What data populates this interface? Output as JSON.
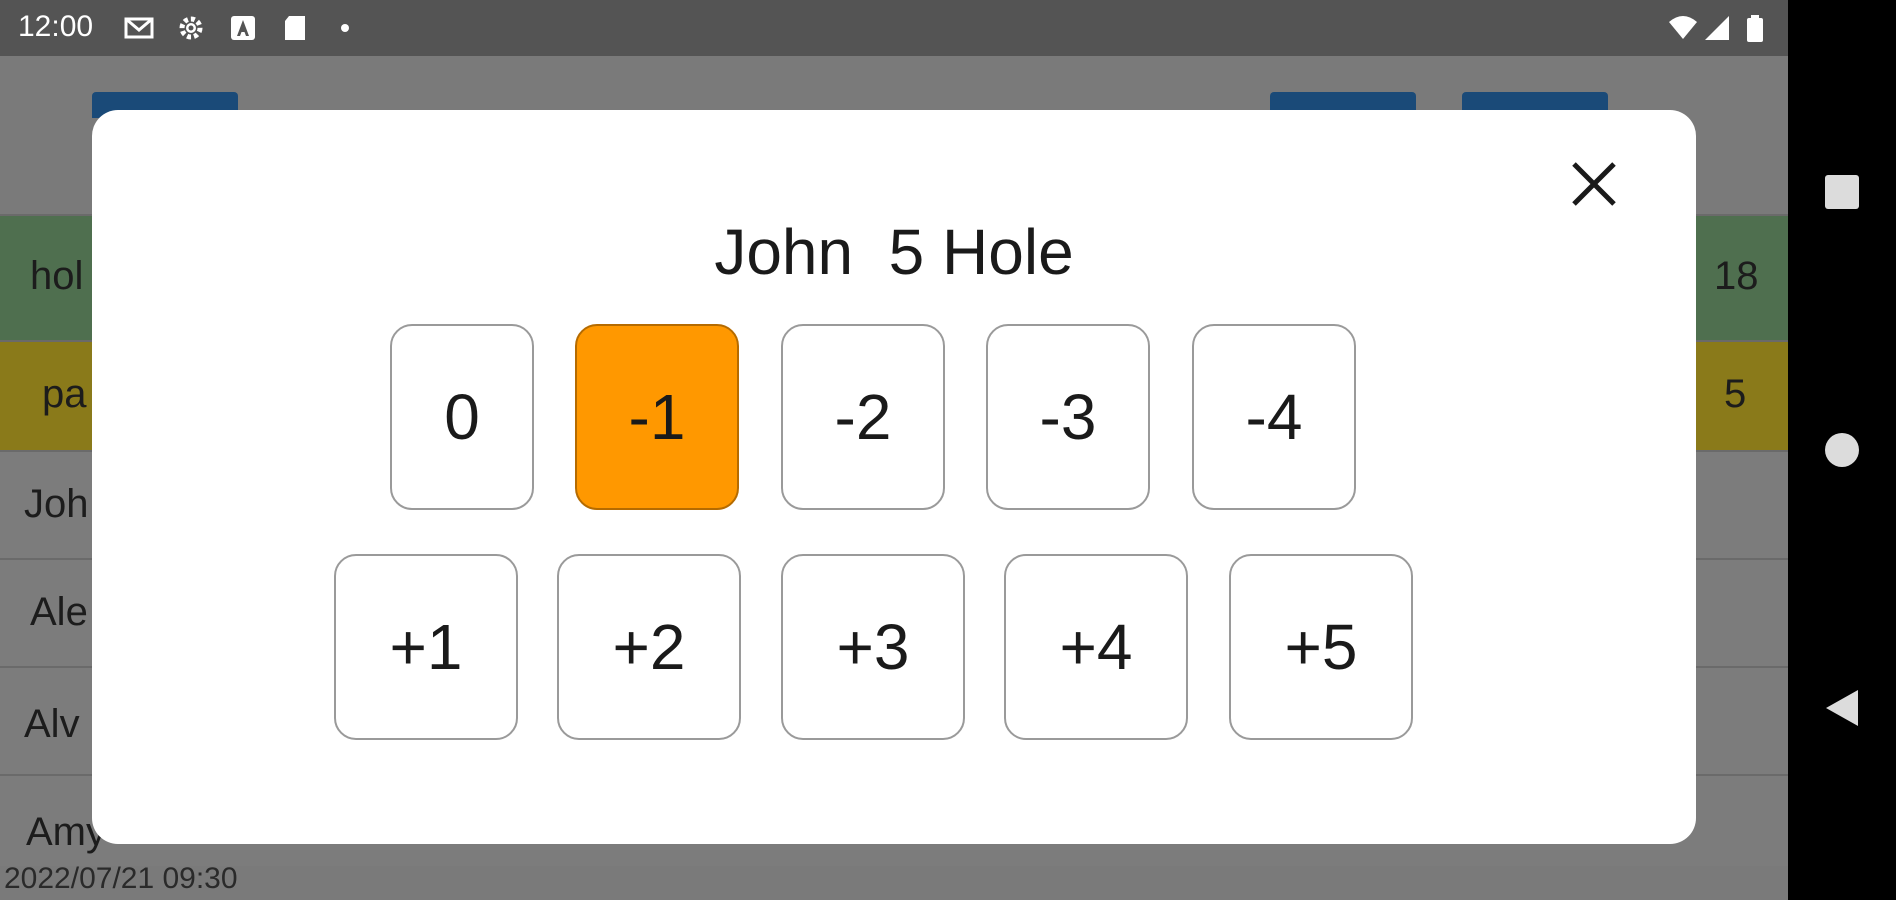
{
  "status_bar": {
    "time": "12:00",
    "left_icons": [
      "gmail-icon",
      "settings-icon",
      "font-a-icon",
      "sd-card-icon",
      "dot-icon"
    ],
    "right_icons": [
      "wifi-icon",
      "signal-icon",
      "battery-icon"
    ]
  },
  "background": {
    "hole_row": {
      "label": "hol",
      "right_value": "18"
    },
    "par_row": {
      "label": "pa",
      "right_value": "5"
    },
    "players": [
      "Joh",
      "Ale",
      "Alv",
      "Amy"
    ],
    "footer_timestamp": "2022/07/21 09:30"
  },
  "dialog": {
    "title": "John  5 Hole",
    "selected_value": "-1",
    "row1": [
      "0",
      "-1",
      "-2",
      "-3",
      "-4"
    ],
    "row2": [
      "+1",
      "+2",
      "+3",
      "+4",
      "+5"
    ],
    "close_icon": "close-icon"
  },
  "nav_bar": {
    "icons": [
      "recents-icon",
      "home-icon",
      "back-icon"
    ]
  },
  "colors": {
    "selected": "#ff9800",
    "hole_row": "#4f6f4f",
    "par_row": "#8a7a1a",
    "status_bar": "#545454"
  }
}
